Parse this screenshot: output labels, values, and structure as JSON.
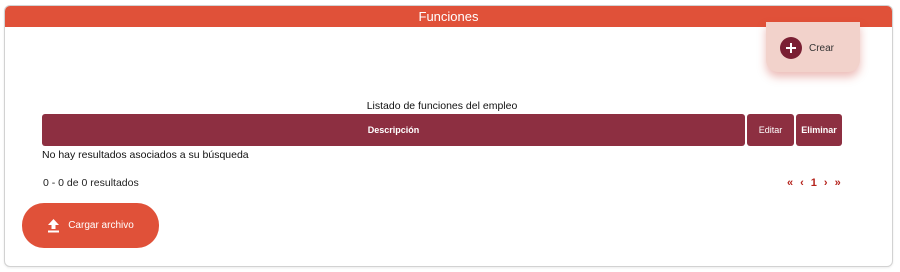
{
  "header": {
    "title": "Funciones"
  },
  "actions": {
    "create_label": "Crear",
    "upload_label": "Cargar archivo"
  },
  "table": {
    "caption": "Listado de funciones del empleo",
    "columns": [
      "Descripción",
      "Editar",
      "Eliminar"
    ],
    "empty_message": "No hay resultados asociados a su búsqueda"
  },
  "pagination": {
    "summary": "0 - 0 de 0 resultados",
    "first": "«",
    "prev": "‹",
    "current_page": "1",
    "next": "›",
    "last": "»"
  },
  "icons": {
    "create": "plus-circle-icon",
    "upload": "upload-icon"
  },
  "colors": {
    "accent": "#e05139",
    "table_header": "#8d2f41",
    "pager": "#b5231c",
    "create_icon": "#7a1f33"
  }
}
